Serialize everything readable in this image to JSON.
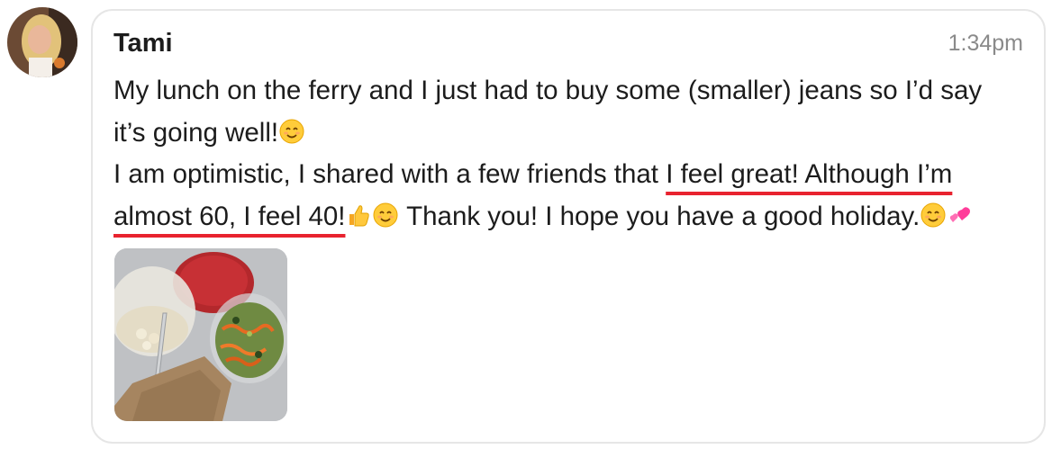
{
  "message": {
    "sender": "Tami",
    "time": "1:34pm",
    "line1": "My lunch on the ferry and I just had to buy some (smaller) jeans so I’d say",
    "line2": "it’s going well!",
    "line3_plain": "I am optimistic, I shared with a few friends that ",
    "line3_highlight": "I feel great! Although I’m",
    "line4_highlight": "almost 60, I feel 40!",
    "line4_plain": " Thank you! I hope you have a good holiday."
  },
  "icons": {
    "emoji_smile": "smiling-face-emoji",
    "emoji_thumbs_up": "thumbs-up-emoji",
    "emoji_hearts": "two-hearts-emoji"
  },
  "colors": {
    "highlight_underline": "#e8232f",
    "bubble_border": "#e6e6e6",
    "timestamp": "#8a8a8a"
  }
}
